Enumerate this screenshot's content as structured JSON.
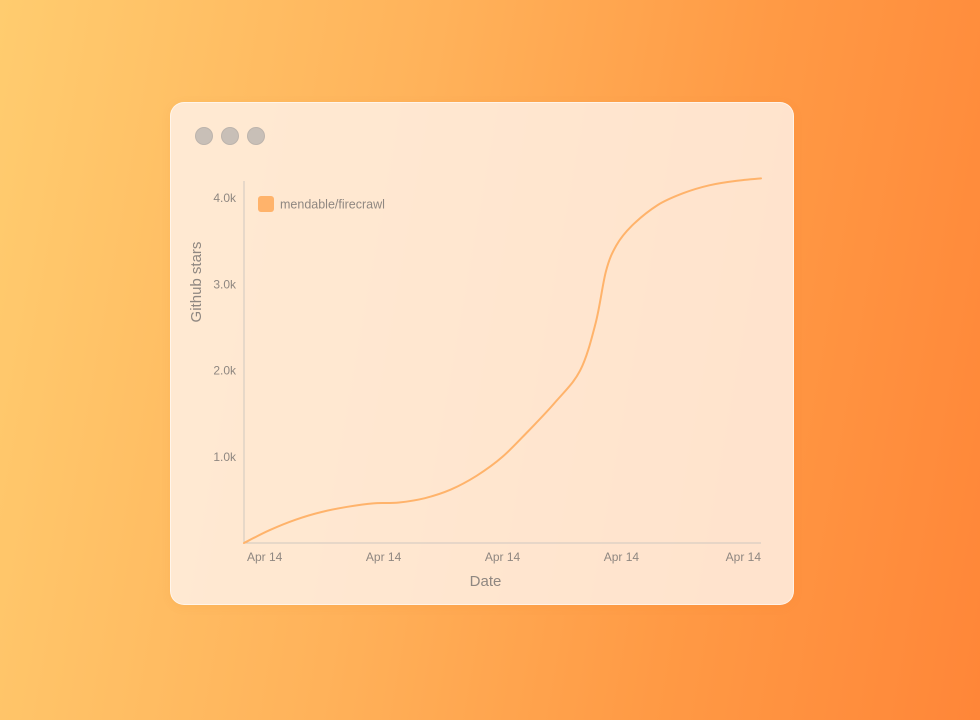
{
  "window": {
    "controls": [
      "close",
      "minimize",
      "maximize"
    ]
  },
  "colors": {
    "series": "#ffb36b",
    "axis": "#cfc7c0",
    "text": "#8f8781"
  },
  "chart_data": {
    "type": "line",
    "title": "",
    "xlabel": "Date",
    "ylabel": "Github stars",
    "ylim": [
      0,
      4200
    ],
    "y_ticks": [
      1000,
      2000,
      3000,
      4000
    ],
    "y_tick_labels": [
      "1.0k",
      "2.0k",
      "3.0k",
      "4.0k"
    ],
    "x_tick_labels": [
      "Apr 14",
      "Apr 14",
      "Apr 14",
      "Apr 14",
      "Apr 14"
    ],
    "x_range": [
      0,
      100
    ],
    "x_ticks": [
      4,
      27,
      50,
      73,
      100
    ],
    "legend": {
      "placement": "top-left"
    },
    "grid": false,
    "series": [
      {
        "name": "mendable/firecrawl",
        "color": "#ffb36b",
        "points": [
          [
            0,
            0
          ],
          [
            5,
            150
          ],
          [
            10,
            270
          ],
          [
            15,
            360
          ],
          [
            20,
            420
          ],
          [
            25,
            460
          ],
          [
            30,
            470
          ],
          [
            35,
            520
          ],
          [
            40,
            620
          ],
          [
            45,
            780
          ],
          [
            50,
            1000
          ],
          [
            55,
            1300
          ],
          [
            60,
            1620
          ],
          [
            65,
            2000
          ],
          [
            68,
            2550
          ],
          [
            70,
            3150
          ],
          [
            72,
            3450
          ],
          [
            75,
            3680
          ],
          [
            80,
            3920
          ],
          [
            85,
            4060
          ],
          [
            90,
            4150
          ],
          [
            95,
            4200
          ],
          [
            100,
            4230
          ]
        ]
      }
    ]
  }
}
